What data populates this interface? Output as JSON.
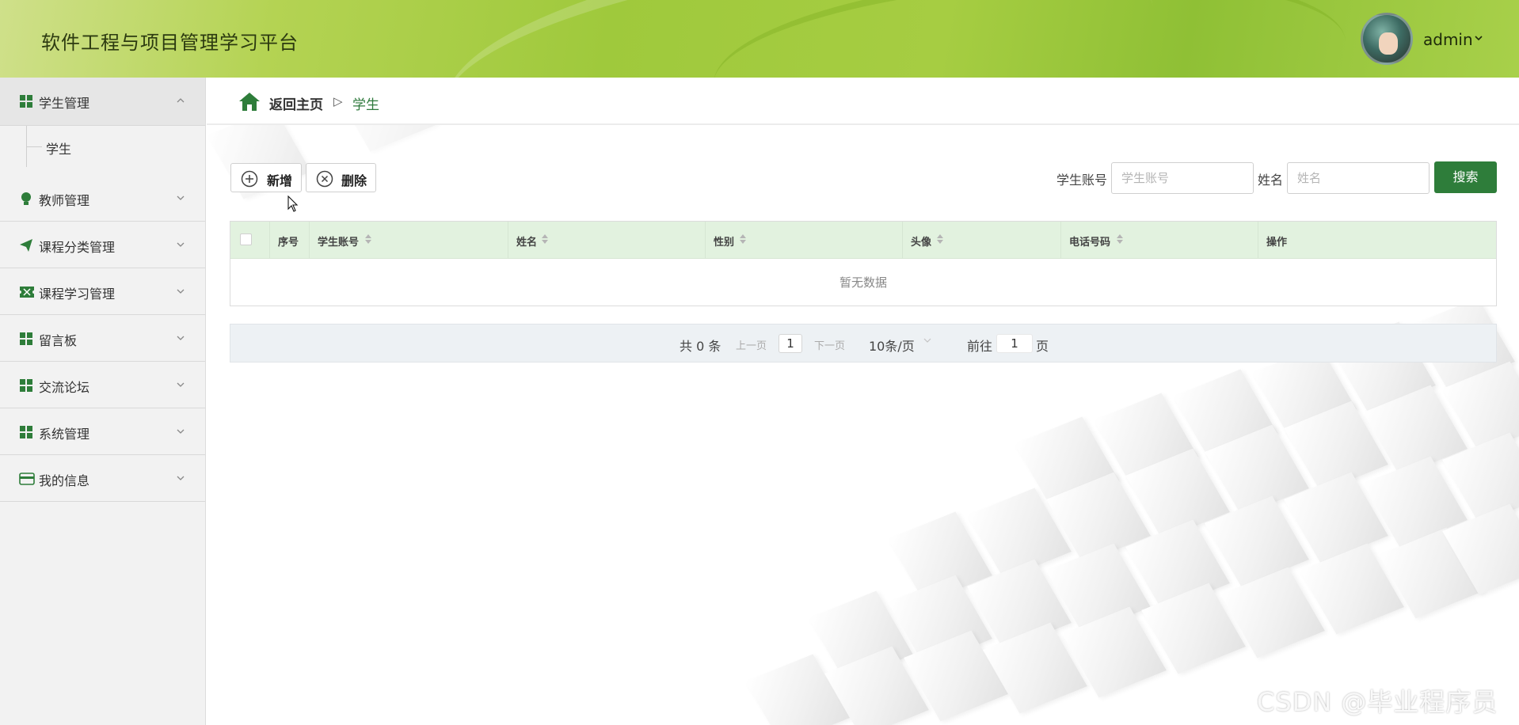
{
  "header": {
    "title": "软件工程与项目管理学习平台",
    "username": "admin",
    "accent": "#9fc93c"
  },
  "sidebar": {
    "items": [
      {
        "label": "学生管理",
        "icon": "grid-icon",
        "expanded": true,
        "children": [
          {
            "label": "学生"
          }
        ]
      },
      {
        "label": "教师管理",
        "icon": "lightbulb-icon"
      },
      {
        "label": "课程分类管理",
        "icon": "paper-plane-icon"
      },
      {
        "label": "课程学习管理",
        "icon": "ticket-icon"
      },
      {
        "label": "留言板",
        "icon": "grid-icon"
      },
      {
        "label": "交流论坛",
        "icon": "grid-icon"
      },
      {
        "label": "系统管理",
        "icon": "grid-icon"
      },
      {
        "label": "我的信息",
        "icon": "card-icon"
      }
    ]
  },
  "breadcrumb": {
    "home": "返回主页",
    "separator": "▷",
    "current": "学生"
  },
  "toolbar": {
    "add_label": "新增",
    "delete_label": "删除"
  },
  "search": {
    "account_label": "学生账号",
    "account_placeholder": "学生账号",
    "name_label": "姓名",
    "name_placeholder": "姓名",
    "button_label": "搜索",
    "button_color": "#2e7d3a"
  },
  "table": {
    "columns": [
      "序号",
      "学生账号",
      "姓名",
      "性别",
      "头像",
      "电话号码",
      "操作"
    ],
    "empty_text": "暂无数据",
    "header_color": "#e2f2df"
  },
  "pagination": {
    "total": "共 0 条",
    "prev": "上一页",
    "page": "1",
    "next": "下一页",
    "page_size": "10条/页",
    "goto_label": "前往",
    "goto_value": "1",
    "page_suffix": "页"
  },
  "watermark": "CSDN @毕业程序员"
}
